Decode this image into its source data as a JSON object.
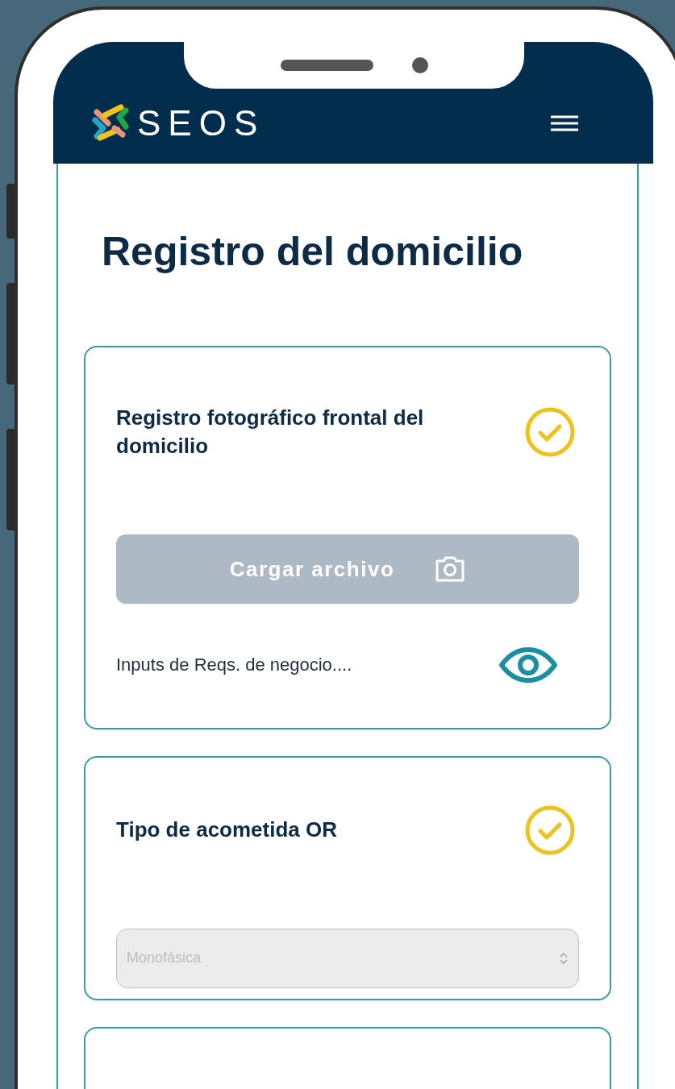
{
  "header": {
    "logo_text": "SEOS"
  },
  "page": {
    "title": "Registro del domicilio"
  },
  "cards": [
    {
      "kind": "upload",
      "title": "Registro fotográfico frontal del domicilio",
      "completed": true,
      "button": {
        "label": "Cargar archivo",
        "disabled": true
      },
      "note": "Inputs de Reqs. de negocio...."
    },
    {
      "kind": "select",
      "title": "Tipo de acometida OR",
      "completed": true,
      "select": {
        "value": "Monofásica",
        "disabled": true
      }
    },
    {
      "kind": "empty"
    }
  ]
}
